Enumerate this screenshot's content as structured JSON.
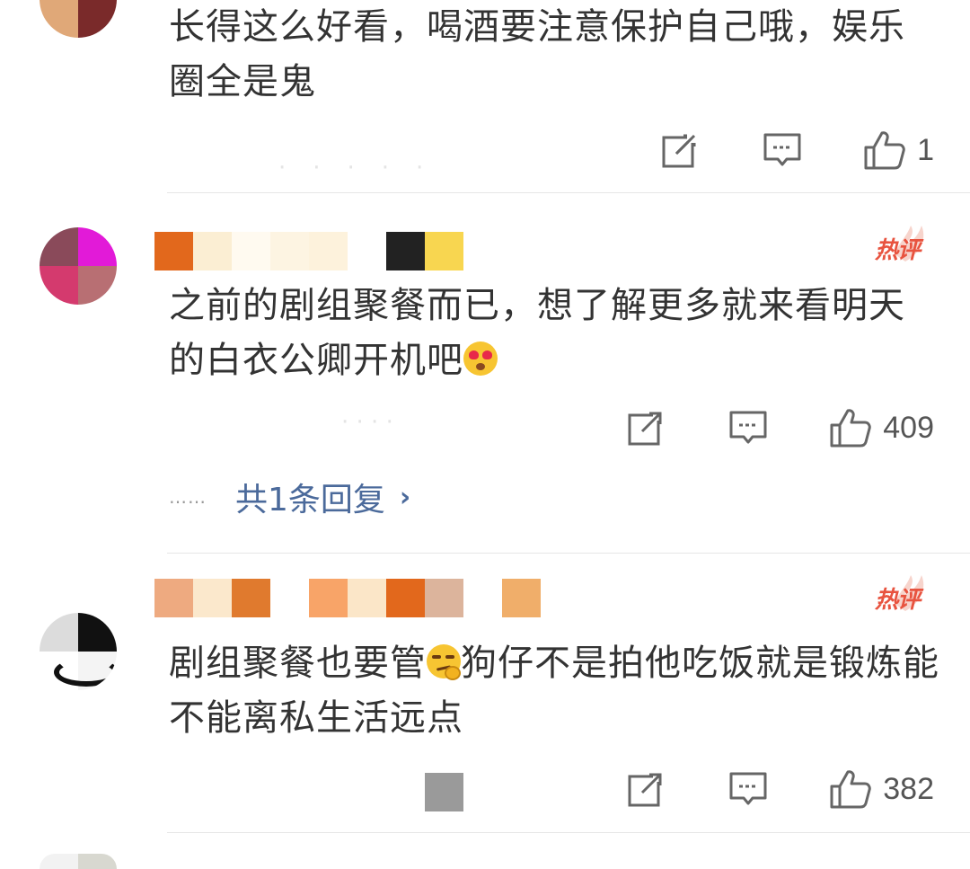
{
  "comments": [
    {
      "text": "长得这么好看，喝酒要注意保护自己哦，娱乐圈全是鬼",
      "likes": "1",
      "hot_badge": ""
    },
    {
      "text": "之前的剧组聚餐而已，想了解更多就来看明天的白衣公卿开机吧",
      "likes": "409",
      "hot_badge": "热评",
      "reply_link": "共1条回复",
      "reply_dots": "……"
    },
    {
      "text": "剧组聚餐也要管",
      "text_after_emoji": "狗仔不是拍他吃饭就是锻炼能不能离私生活远点",
      "likes": "382",
      "hot_badge": "热评"
    }
  ],
  "icons": {
    "share": "share-icon",
    "comment": "comment-icon",
    "like": "thumbs-up-icon",
    "heart_eyes": "heart-eyes-emoji",
    "thinking": "smirk-emoji"
  },
  "colors": {
    "hot_badge": "#e8533f",
    "link": "#4b6a9b",
    "text": "#333333",
    "divider": "#e6e6e6"
  }
}
